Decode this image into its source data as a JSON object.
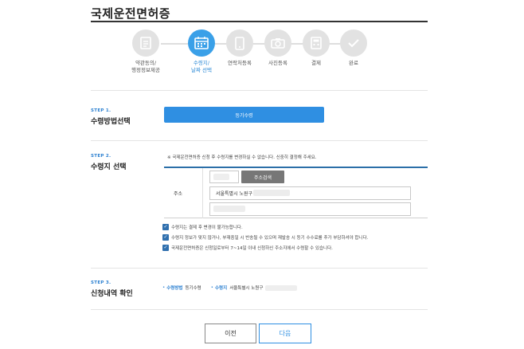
{
  "page": {
    "title": "국제운전면허증"
  },
  "steps": [
    {
      "label_line1": "약관동의/",
      "label_line2": "행정정보제공",
      "icon": "document-icon",
      "active": false
    },
    {
      "label_line1": "수령지/",
      "label_line2": "날짜 선택",
      "icon": "calendar-icon",
      "active": true
    },
    {
      "label_line1": "연락처등록",
      "label_line2": "",
      "icon": "phone-icon",
      "active": false
    },
    {
      "label_line1": "사진등록",
      "label_line2": "",
      "icon": "camera-icon",
      "active": false
    },
    {
      "label_line1": "결제",
      "label_line2": "",
      "icon": "payment-icon",
      "active": false
    },
    {
      "label_line1": "완료",
      "label_line2": "",
      "icon": "check-icon",
      "active": false
    }
  ],
  "step1": {
    "tag": "STEP 1.",
    "title": "수령방법선택",
    "method_button": "등기수령"
  },
  "step2": {
    "tag": "STEP 2.",
    "title": "수령지 선택",
    "notice": "※ 국제운전면허증 신청 후 수령지를 변경하실 수 없습니다. 신중히 결정해 주세요.",
    "address_label": "주소",
    "search_button": "주소검색",
    "address_line1": "서울특별시 노원구",
    "checks": [
      "수령지는 결제 후 변경이 불가능합니다.",
      "수령지 정보가 맞지 않거나, 부재중일 시 반송될 수 있으며 재발송 시 등기 수수료를 추가 부담하셔야 합니다.",
      "국제운전면허증은 신청일로부터 7~14일 이내 신청하신 주소지에서 수령할 수 있습니다."
    ]
  },
  "step3": {
    "tag": "STEP 3.",
    "title": "신청내역 확인",
    "method_key": "수령방법",
    "method_value": "등기수령",
    "place_key": "수령지",
    "place_value": "서울특별시 노원구"
  },
  "buttons": {
    "prev": "이전",
    "next": "다음"
  },
  "colors": {
    "accent": "#2f8fe2",
    "active_step": "#3aa0e8",
    "checkbox": "#2f6fae"
  }
}
